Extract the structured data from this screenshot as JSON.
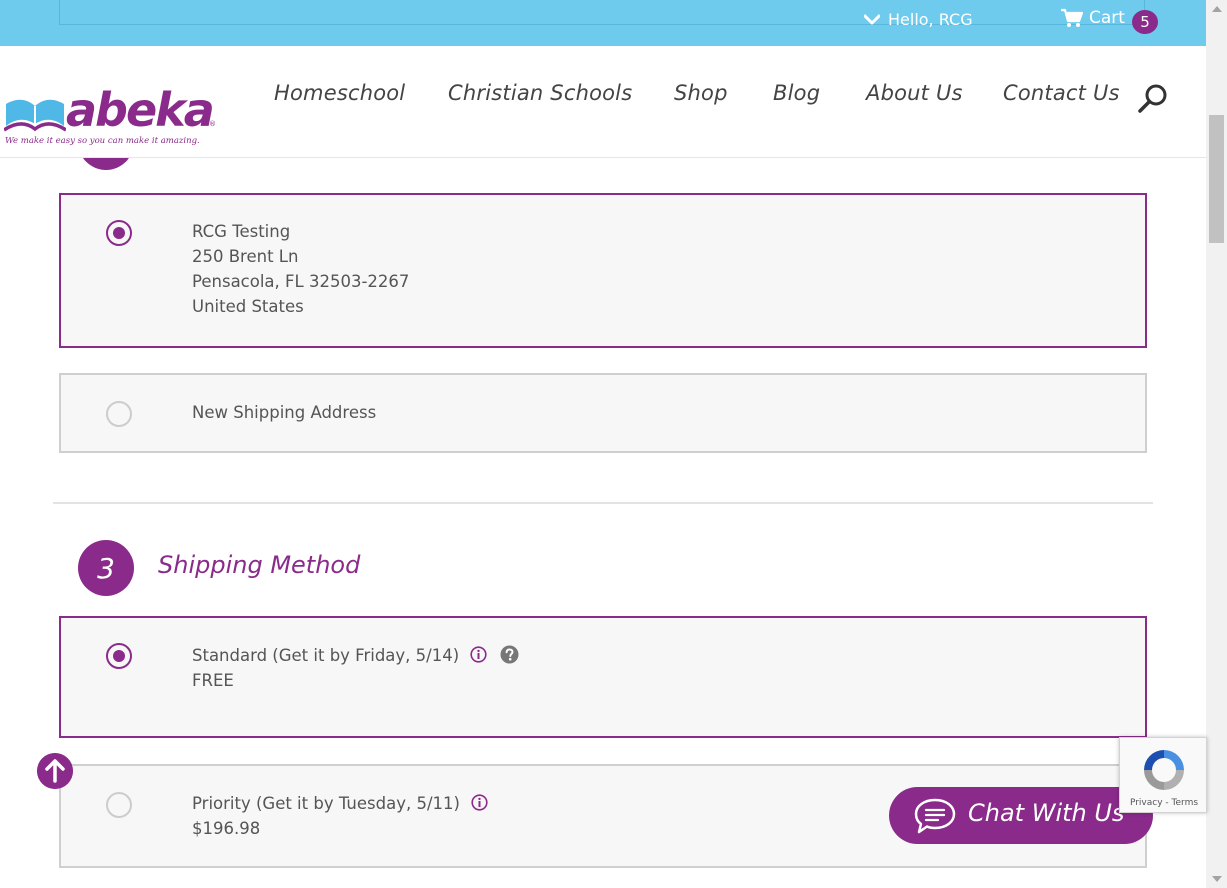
{
  "topbar": {
    "greeting": "Hello, RCG",
    "cart_label": "Cart",
    "cart_count": "5"
  },
  "header": {
    "logo_text": "abeka",
    "logo_registered": "®",
    "logo_tagline": "We make it easy so you can make it amazing.",
    "nav": [
      {
        "label": "Homeschool"
      },
      {
        "label": "Christian Schools"
      },
      {
        "label": "Shop"
      },
      {
        "label": "Blog"
      },
      {
        "label": "About Us"
      },
      {
        "label": "Contact Us"
      }
    ],
    "search_icon": "search-icon"
  },
  "shipping_address": {
    "options": [
      {
        "selected": true,
        "lines": [
          "RCG Testing",
          "250 Brent Ln",
          "Pensacola, FL 32503-2267",
          "United States"
        ]
      },
      {
        "selected": false,
        "lines": [
          "New Shipping Address"
        ]
      }
    ]
  },
  "shipping_method": {
    "step_number": "3",
    "title": "Shipping Method",
    "options": [
      {
        "selected": true,
        "label": "Standard (Get it by Friday, 5/14)",
        "price": "FREE",
        "icons": [
          "info-icon",
          "help-icon"
        ]
      },
      {
        "selected": false,
        "label": "Priority (Get it by Tuesday, 5/11)",
        "price": "$196.98",
        "icons": [
          "info-icon"
        ]
      }
    ]
  },
  "chat": {
    "label": "Chat With Us"
  },
  "recaptcha": {
    "privacy": "Privacy",
    "separator": "-",
    "terms": "Terms"
  },
  "colors": {
    "brand_purple": "#8a2a8b",
    "topbar_blue": "#6fcbee",
    "option_bg": "#f7f7f7"
  }
}
